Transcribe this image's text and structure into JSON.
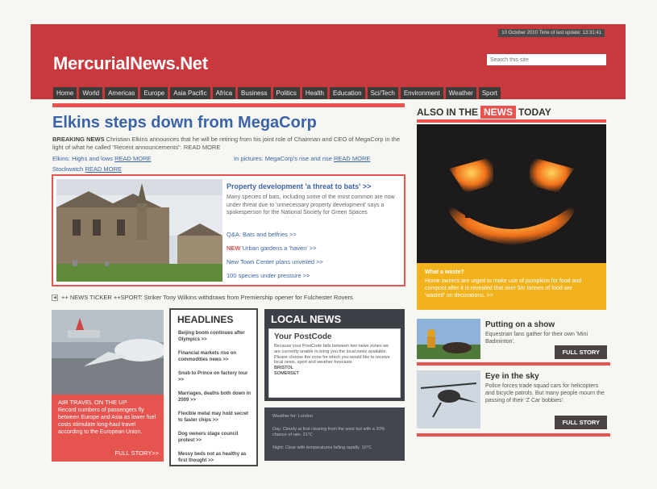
{
  "header": {
    "dateline": "10 October 2010 Time of last update: 13:31:41",
    "logo": "MercurialNews.Net",
    "search_placeholder": "Search this site",
    "nav": [
      "Home",
      "World",
      "Americas",
      "Europe",
      "Asia Pacific",
      "Africa",
      "Business",
      "Politics",
      "Health",
      "Education",
      "Sci/Tech",
      "Environment",
      "Weather",
      "Sport"
    ]
  },
  "main": {
    "headline": "Elkins steps down from MegaCorp",
    "lead_label": "BREAKING NEWS",
    "lead_text": " Christian Elkins announces that he will be retiring from his joint role of Chairman and CEO of MegaCorp in the light of what he called \"Recent announcements\". READ MORE",
    "sub_left_1": "Elkins: Highs and lows ",
    "sub_left_1_link": "READ MORE",
    "sub_left_2": "Stockwatch ",
    "sub_left_2_link": "READ MORE",
    "sub_right": "In pictures: MegaCorp's rise and rise ",
    "sub_right_link": "READ MORE"
  },
  "feature": {
    "title": "Property development 'a threat to bats' >>",
    "text": "Many species of bats, including some of the most common are now under threat due to 'unnecessary property development' says a spokesperson for the National Society for Green Spaces",
    "link1": "Q&A: Bats and belfries >>",
    "new_tag": "NEW",
    "link2": " Urban gardens a 'haven' >>",
    "link3": "New Town Center plans unveiled >>",
    "link4": "100 species under pressure >>"
  },
  "ticker": {
    "text": "++ NEWS TICKER ++SPORT: Striker Tony Wilkins withdraws from Premiership opener for Fulchester Rovers"
  },
  "air": {
    "title": "AIR TRAVEL ON THE UP",
    "text": "Record numbers of passengers fly between Europe and Asia as lower fuel costs stimulate long-haul travel according to the European Union.",
    "more": "FULL STORY>>"
  },
  "headlines": {
    "title": "HEADLINES",
    "items": [
      "Beijing boom continues after Olympics >>",
      "Financial markets rise on commodities news >>",
      "Snub to Prince on factory tour >>",
      "Marriages, deaths both down in 2009 >>",
      "Flexible metal may hold secret to faster chips >>",
      "Dog owners stage council protest >>",
      "Messy beds not as healthy as first thought >>"
    ]
  },
  "local": {
    "title": "LOCAL NEWS",
    "sub": "Your PostCode",
    "text": "Because your PostCode falls between two news zones we are currently unable to bring you the local news available. Please choose the zone for which you would like to receive local news, sport and weather forecasts",
    "zone1": "BRISTOL",
    "zone2": "SOMERSET"
  },
  "weather": {
    "title": "Weather for: London",
    "day": "Day: Cloudy at first clearing from the west but with a 30% chance of rain. 21°C",
    "night": "Night: Clear with temperatures falling rapidly. 10°C"
  },
  "right": {
    "also_prefix": "ALSO IN THE",
    "also_badge": "NEWS",
    "also_suffix": "TODAY",
    "pumpkin_title": "What a waste?",
    "pumpkin_text": "Home owners are urged to make use of pumpkins for food and compost after it is revealed that over 5m tonnes of food are 'wasted' on decorations. >>",
    "story1_title": "Putting on a show",
    "story1_text": "Equestrian fans gather for their own 'Mini Badminton'.",
    "story2_title": "Eye in the sky",
    "story2_text": "Police forces trade squad cars for helicopters and bicycle patrols. But many people mourn the passing of their 'Z Car bobbies'.",
    "full_story": "FULL STORY"
  },
  "colors": {
    "brand_red": "#c9383d",
    "accent_red": "#e9534f",
    "link_blue": "#3a63a8",
    "dark_gray": "#3e4048",
    "pumpkin_orange": "#f1b21c"
  }
}
